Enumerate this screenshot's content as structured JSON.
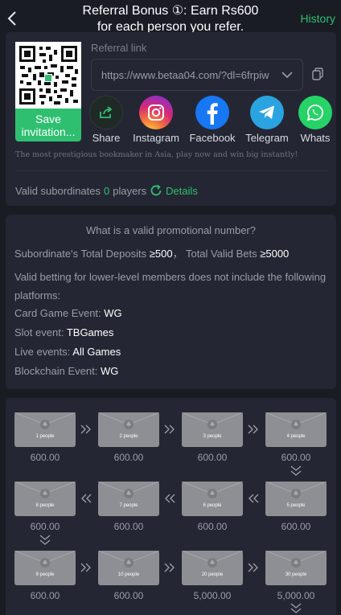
{
  "header": {
    "back_icon": "chevron-left-icon",
    "title_line1": "Referral Bonus ①: Earn Rs600",
    "title_line2": "for each person you refer.",
    "history_label": "History"
  },
  "invite": {
    "save_label_line1": "Save",
    "save_label_line2": "invitation...",
    "referral_label": "Referral link",
    "referral_value": "https://www.betaa04.com/?dl=6frpiw",
    "copy_icon": "copy-icon",
    "socials": [
      {
        "label": "Share",
        "icon": "share-icon"
      },
      {
        "label": "Instagram",
        "icon": "instagram-icon"
      },
      {
        "label": "Facebook",
        "icon": "facebook-icon"
      },
      {
        "label": "Telegram",
        "icon": "telegram-icon"
      },
      {
        "label": "Whats",
        "icon": "whatsapp-icon"
      }
    ],
    "tagline": "The most prestigious bookmaker in Asia, play now and win big instantly!",
    "valid_label": "Valid subordinates",
    "valid_count": "0",
    "valid_unit": "players",
    "details_label": "Details"
  },
  "promo": {
    "title": "What is a valid promotional number?",
    "deposits_label": "Subordinate's Total Deposits",
    "deposits_value": "≥500",
    "bets_label": "Total Valid Bets",
    "bets_value": "≥5000",
    "note_line1": "Valid betting for lower-level members does not include the following",
    "note_line2": "platforms:",
    "card_label": "Card Game Event:",
    "card_value": "WG",
    "slot_label": "Slot event:",
    "slot_value": "TBGames",
    "live_label": "Live events:",
    "live_value": "All Games",
    "chain_label": "Blockchain Event:",
    "chain_value": "WG"
  },
  "rewards": [
    {
      "people": "1 people",
      "amount": "600.00"
    },
    {
      "people": "2 people",
      "amount": "600.00"
    },
    {
      "people": "3 people",
      "amount": "600.00"
    },
    {
      "people": "4 people",
      "amount": "600.00"
    },
    {
      "people": "5 people",
      "amount": "600.00"
    },
    {
      "people": "6 people",
      "amount": "600.00"
    },
    {
      "people": "7 people",
      "amount": "600.00"
    },
    {
      "people": "8 people",
      "amount": "600.00"
    },
    {
      "people": "9 people",
      "amount": "600.00"
    },
    {
      "people": "10 people",
      "amount": "600.00"
    },
    {
      "people": "20 people",
      "amount": "5,000.00"
    },
    {
      "people": "30 people",
      "amount": "5,000.00"
    }
  ],
  "colors": {
    "accent": "#2fbf71",
    "background": "#1a1c24",
    "card": "#242733"
  }
}
